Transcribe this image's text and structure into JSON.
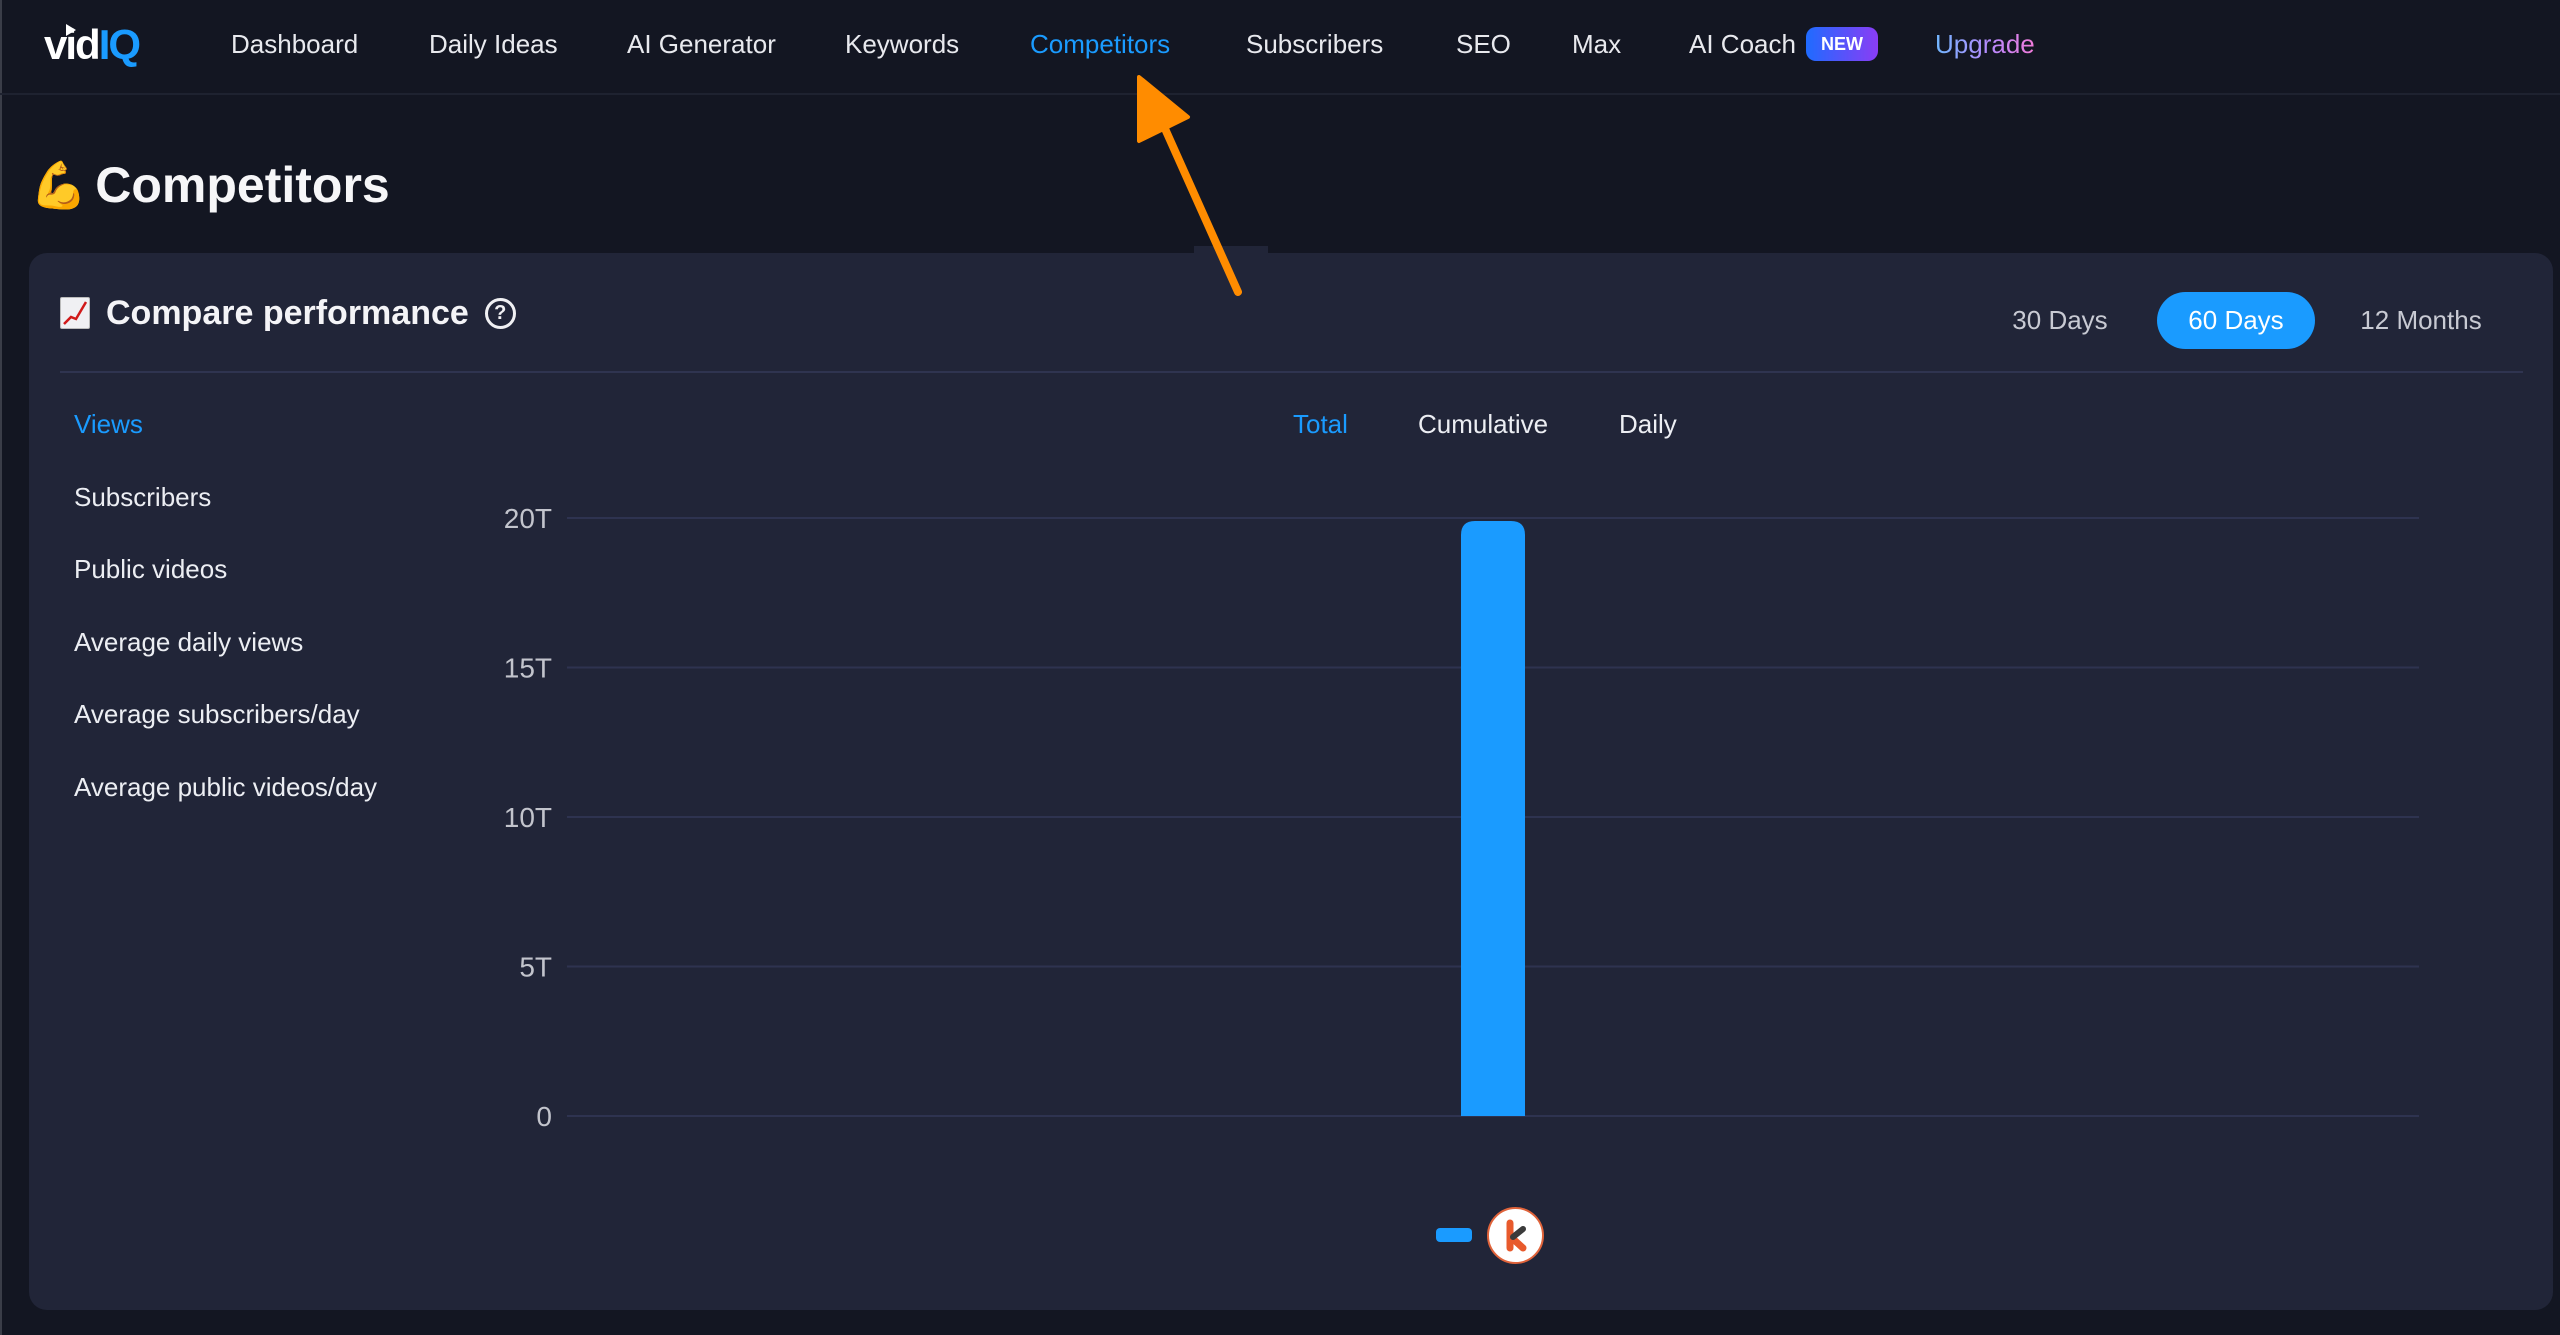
{
  "brand": {
    "logo_left": "vid",
    "logo_right": "IQ"
  },
  "nav": {
    "items": [
      {
        "label": "Dashboard",
        "active": false
      },
      {
        "label": "Daily Ideas",
        "active": false
      },
      {
        "label": "AI Generator",
        "active": false
      },
      {
        "label": "Keywords",
        "active": false
      },
      {
        "label": "Competitors",
        "active": true
      },
      {
        "label": "Subscribers",
        "active": false
      },
      {
        "label": "SEO",
        "active": false
      },
      {
        "label": "Max",
        "active": false
      },
      {
        "label": "AI Coach",
        "active": false,
        "badge": "NEW"
      },
      {
        "label": "Upgrade",
        "active": false
      }
    ]
  },
  "page": {
    "title_emoji": "💪",
    "title": "Competitors"
  },
  "card": {
    "title_icon": "chart-increasing-icon",
    "title": "Compare performance",
    "help_glyph": "?",
    "periods": [
      {
        "label": "30 Days",
        "active": false
      },
      {
        "label": "60 Days",
        "active": true
      },
      {
        "label": "12 Months",
        "active": false
      }
    ],
    "metrics": [
      {
        "label": "Views",
        "active": true
      },
      {
        "label": "Subscribers",
        "active": false
      },
      {
        "label": "Public videos",
        "active": false
      },
      {
        "label": "Average daily views",
        "active": false
      },
      {
        "label": "Average subscribers/day",
        "active": false
      },
      {
        "label": "Average public videos/day",
        "active": false
      }
    ],
    "modes": [
      {
        "label": "Total",
        "active": true
      },
      {
        "label": "Cumulative",
        "active": false
      },
      {
        "label": "Daily",
        "active": false
      }
    ],
    "legend": [
      {
        "color": "#1a9bff",
        "avatar_letter": "k",
        "avatar_color": "#e85a2c"
      }
    ]
  },
  "colors": {
    "accent": "#1a9bff",
    "background": "#131622",
    "card": "#212538",
    "annotation_arrow": "#ff8c00"
  },
  "chart_data": {
    "type": "bar",
    "title": "",
    "xlabel": "",
    "ylabel": "",
    "categories": [
      ""
    ],
    "series": [
      {
        "name": "k",
        "color": "#1a9bff",
        "values": [
          19.9
        ]
      }
    ],
    "unit_suffix": "T",
    "ylim": [
      0,
      20
    ],
    "yticks": [
      0,
      5,
      10,
      15,
      20
    ],
    "ytick_labels": [
      "0",
      "5T",
      "10T",
      "15T",
      "20T"
    ],
    "grid": true,
    "legend": "bottom-center"
  }
}
